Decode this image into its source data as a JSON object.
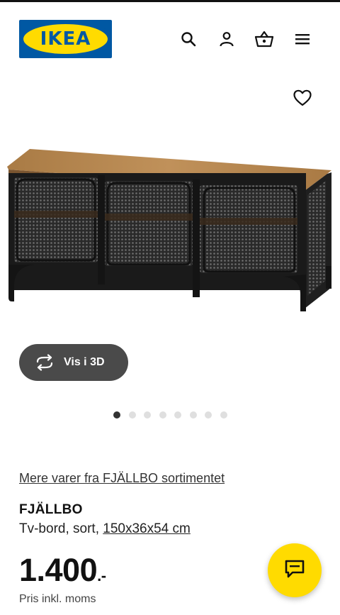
{
  "header": {
    "logo_text": "IKEA",
    "logo_reg": "®",
    "icons": [
      "search-icon",
      "account-icon",
      "basket-icon",
      "menu-icon"
    ]
  },
  "product": {
    "favourite_icon": "heart-icon",
    "view_3d_label": "Vis i 3D",
    "carousel": {
      "total": 8,
      "active_index": 0
    },
    "range_link": "Mere varer fra FJÄLLBO sortimentet",
    "name": "FJÄLLBO",
    "description": "Tv-bord, sort, ",
    "size_link": "150x36x54 cm",
    "price": "1.400",
    "price_suffix": ".-",
    "price_note": "Pris inkl. moms"
  },
  "chat": {
    "icon": "chat-icon"
  },
  "colors": {
    "brand_blue": "#0058a3",
    "brand_yellow": "#ffdb00",
    "button_dark": "#4a4a4a"
  }
}
